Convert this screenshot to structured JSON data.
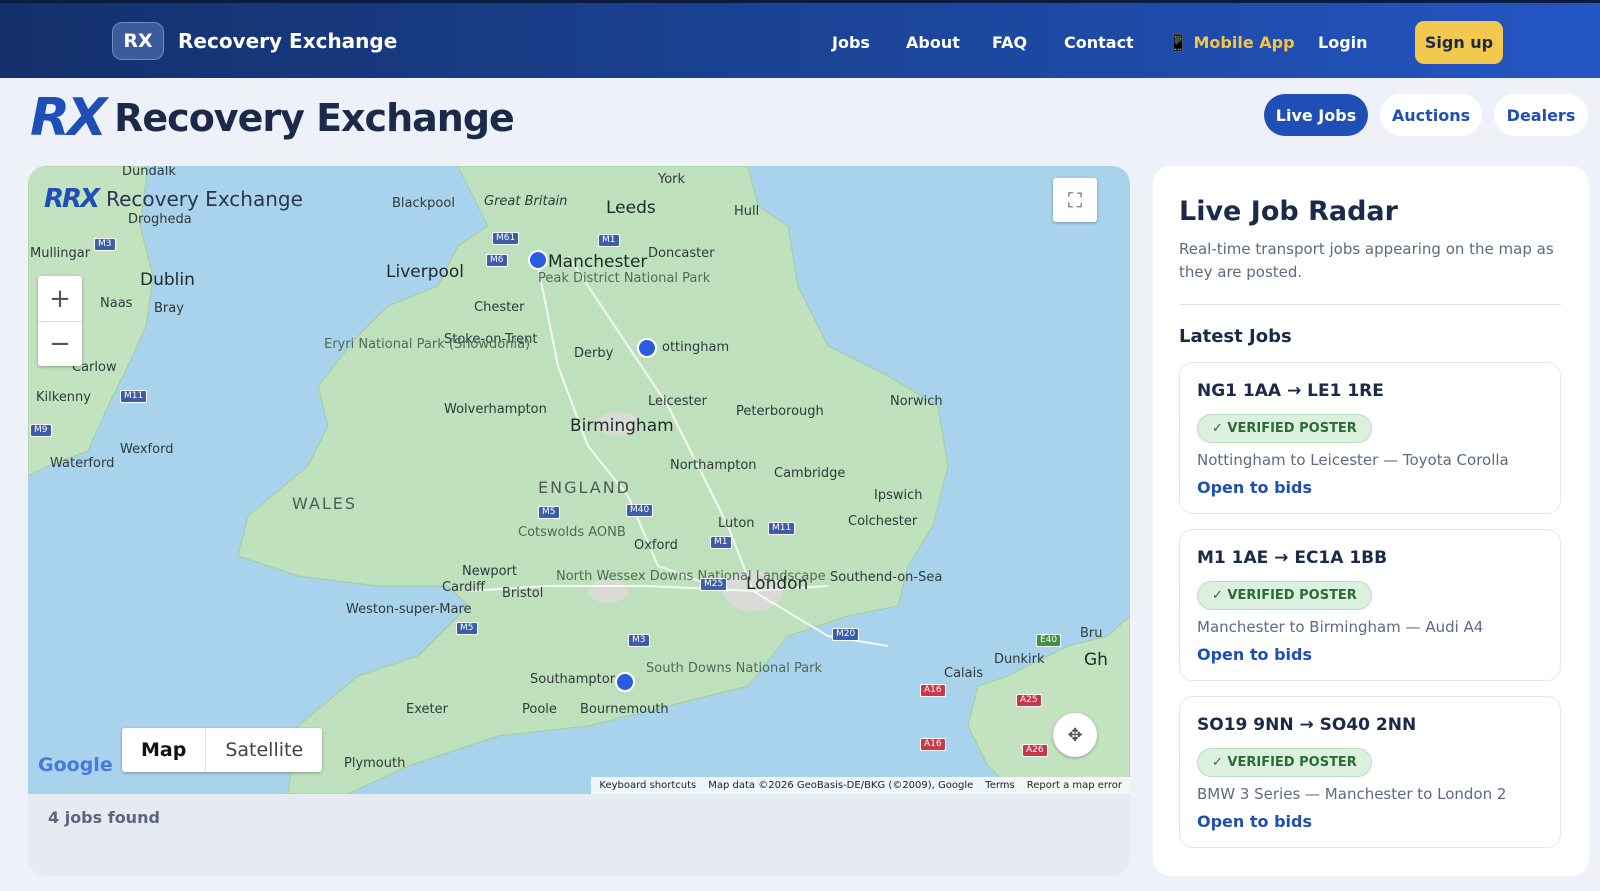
{
  "nav": {
    "badge": "RX",
    "brand": "Recovery Exchange",
    "links": [
      "Jobs",
      "About",
      "FAQ",
      "Contact"
    ],
    "mobile_app": "📱 Mobile App",
    "login": "Login",
    "signup": "Sign up"
  },
  "header": {
    "logo_mark": "RX",
    "logo_name": "Recovery Exchange",
    "pills": [
      "Live Jobs",
      "Auctions",
      "Dealers"
    ]
  },
  "map": {
    "logo_mark": "RRX",
    "logo_name": "Recovery Exchange",
    "zoom_in": "+",
    "zoom_out": "−",
    "fullscreen": "⛶",
    "compass": "✥",
    "type_map": "Map",
    "type_satellite": "Satellite",
    "google": "Google",
    "attribution": [
      "Keyboard shortcuts",
      "Map data ©2026 GeoBasis-DE/BKG (©2009), Google",
      "Terms",
      "Report a map error"
    ],
    "places": [
      "Dundalk",
      "Drogheda",
      "Mullingar",
      "Dublin",
      "Naas",
      "Bray",
      "Carlow",
      "Kilkenny",
      "Wexford",
      "Waterford",
      "Blackpool",
      "Great Britain",
      "York",
      "Leeds",
      "Hull",
      "Liverpool",
      "Manchester",
      "Doncaster",
      "Peak District National Park",
      "Chester",
      "Stoke-on-Trent",
      "Derby",
      "ottingham",
      "Eryri National Park (Snowdonia)",
      "Wolverhampton",
      "Leicester",
      "Peterborough",
      "Norwich",
      "Birmingham",
      "Northampton",
      "Cambridge",
      "WALES",
      "ENGLAND",
      "Ipswich",
      "Luton",
      "Colchester",
      "Cotswolds AONB",
      "Oxford",
      "Newport",
      "Cardiff",
      "Bristol",
      "North Wessex Downs National Landscape",
      "London",
      "Southend-on-Sea",
      "Weston-super-Mare",
      "Southamptor",
      "South Downs National Park",
      "Calais",
      "Dunkirk",
      "Exeter",
      "Poole",
      "Bournemouth",
      "Plymouth",
      "Bru",
      "Gh"
    ],
    "roads": [
      "M3",
      "M61",
      "M1",
      "M6",
      "M9",
      "M11",
      "M5",
      "M40",
      "M11",
      "M1",
      "M25",
      "M5",
      "M3",
      "M20",
      "E40",
      "A16",
      "A25",
      "A16",
      "A26"
    ],
    "jobs_found": "4 jobs found"
  },
  "sidebar": {
    "title": "Live Job Radar",
    "subtitle": "Real-time transport jobs appearing on the map as they are posted.",
    "latest": "Latest Jobs",
    "jobs": [
      {
        "route": "NG1 1AA → LE1 1RE",
        "badge": "✓ VERIFIED POSTER",
        "desc": "Nottingham to Leicester — Toyota Corolla",
        "cta": "Open to bids"
      },
      {
        "route": "M1 1AE → EC1A 1BB",
        "badge": "✓ VERIFIED POSTER",
        "desc": "Manchester to Birmingham — Audi A4",
        "cta": "Open to bids"
      },
      {
        "route": "SO19 9NN → SO40 2NN",
        "badge": "✓ VERIFIED POSTER",
        "desc": "BMW 3 Series — Manchester to London 2",
        "cta": "Open to bids"
      }
    ]
  },
  "colors": {
    "nav": "#1e4aa6",
    "accent": "#1f4fb6",
    "signup": "#f3c84e",
    "water": "#a9d3ec",
    "land": "#bfe0bd",
    "pin": "#2a5be0"
  }
}
